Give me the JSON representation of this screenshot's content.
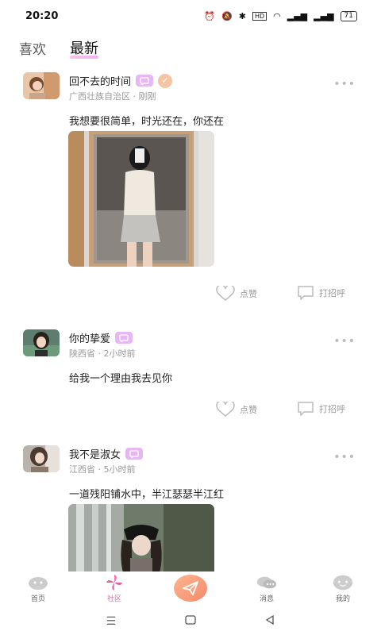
{
  "status": {
    "time": "20:20",
    "battery": "71"
  },
  "tabs": [
    {
      "label": "喜欢"
    },
    {
      "label": "最新"
    }
  ],
  "posts": [
    {
      "name": "回不去的时间",
      "location": "广西壮族自治区 · 刚刚",
      "content": "我想要很简单，时光还在，你还在",
      "like_label": "点赞",
      "greet_label": "打招呼"
    },
    {
      "name": "你的挚爱",
      "location": "陕西省 · 2小时前",
      "content": "给我一个理由我去见你",
      "like_label": "点赞",
      "greet_label": "打招呼"
    },
    {
      "name": "我不是淑女",
      "location": "江西省 · 5小时前",
      "content": "一道残阳铺水中，半江瑟瑟半江红"
    }
  ],
  "nav": [
    {
      "label": "首页",
      "icon": "home-icon"
    },
    {
      "label": "社区",
      "icon": "pinwheel-icon"
    },
    {
      "label": "",
      "icon": "paper-plane-icon"
    },
    {
      "label": "消息",
      "icon": "chat-bubbles-icon"
    },
    {
      "label": "我的",
      "icon": "face-icon"
    }
  ],
  "colors": {
    "accent": "#e55fa5",
    "badge": "#e7b6f5",
    "post_button": "#f4896e"
  }
}
